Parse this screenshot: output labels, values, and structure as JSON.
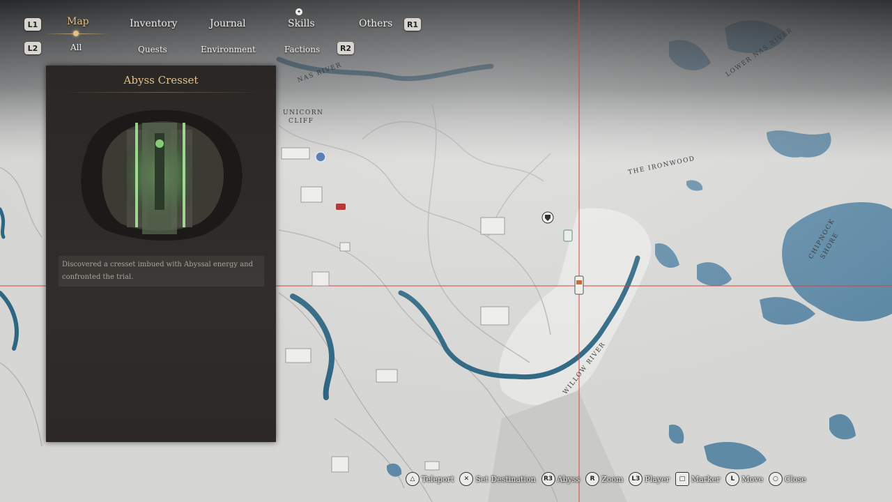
{
  "top_tabs": {
    "l1": "L1",
    "r1": "R1",
    "map": "Map",
    "inventory": "Inventory",
    "journal": "Journal",
    "skills": "Skills",
    "others": "Others"
  },
  "sub_tabs": {
    "l2": "L2",
    "r2": "R2",
    "all": "All",
    "quests": "Quests",
    "environment": "Environment",
    "factions": "Factions"
  },
  "panel": {
    "title": "Abyss Cresset",
    "description": "Discovered a cresset imbued with Abyssal energy and confronted the trial."
  },
  "map_labels": {
    "nas_river": "NAS RIVER",
    "unicorn": "UNICORN",
    "cliff": "CLIFF",
    "the_ironwood": "THE IRONWOOD",
    "lower_nas_river": "LOWER NAS RIVER",
    "chipnock": "CHIPNOCK",
    "shore": "SHORE",
    "willow_river": "WILLOW RIVER"
  },
  "hints": [
    {
      "icon": "triangle-icon",
      "glyph": "△",
      "label": "Teleport"
    },
    {
      "icon": "cross-icon",
      "glyph": "✕",
      "label": "Set Destination"
    },
    {
      "icon": "r3-icon",
      "glyph": "R3",
      "label": "Abyss"
    },
    {
      "icon": "r-stick-icon",
      "glyph": "R",
      "label": "Zoom"
    },
    {
      "icon": "l3-icon",
      "glyph": "L3",
      "label": "Player"
    },
    {
      "icon": "square-icon",
      "glyph": "□",
      "label": "Marker"
    },
    {
      "icon": "l-stick-icon",
      "glyph": "L",
      "label": "Move"
    },
    {
      "icon": "circle-icon",
      "glyph": "○",
      "label": "Close"
    }
  ],
  "colors": {
    "water": "#5f8aa6",
    "land": "#d9d9d7",
    "crosshair": "#d9453a",
    "accent_gold": "#e4c08a",
    "panel_bg": "#2d2a27"
  }
}
